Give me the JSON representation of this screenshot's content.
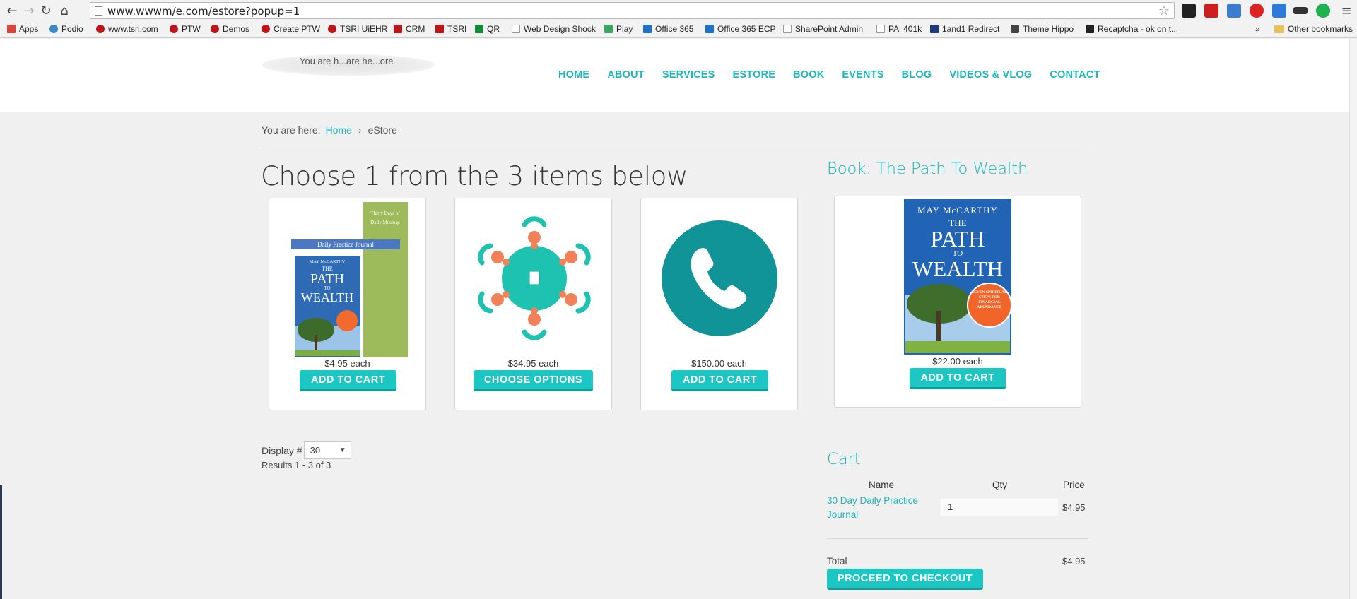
{
  "browser": {
    "url": "www.wwwm/e.com/estore?popup=1",
    "bookmarks": [
      {
        "label": "Apps",
        "color": "#d9453b"
      },
      {
        "label": "Podio",
        "color": "#3b88c3"
      },
      {
        "label": "www.tsri.com",
        "color": "#c0141b"
      },
      {
        "label": "PTW",
        "color": "#c0141b"
      },
      {
        "label": "Demos",
        "color": "#c0141b"
      },
      {
        "label": "Create PTW",
        "color": "#c0141b"
      },
      {
        "label": "TSRI UiEHR",
        "color": "#c0141b"
      },
      {
        "label": "CRM",
        "color": "#c0141b"
      },
      {
        "label": "TSRI",
        "color": "#c0141b"
      },
      {
        "label": "QR",
        "color": "#118b38"
      },
      {
        "label": "Web Design Shock",
        "color": "#bbbbbb"
      },
      {
        "label": "Play",
        "color": "#3ba760"
      },
      {
        "label": "Office 365",
        "color": "#1f72c9"
      },
      {
        "label": "Office 365 ECP",
        "color": "#1f72c9"
      },
      {
        "label": "SharePoint Admin",
        "color": "#bbbbbb"
      },
      {
        "label": "PAi 401k",
        "color": "#bbbbbb"
      },
      {
        "label": "1and1 Redirect",
        "color": "#1f3a7a"
      },
      {
        "label": "Theme Hippo",
        "color": "#444444"
      },
      {
        "label": "Recaptcha - ok on t...",
        "color": "#222222"
      }
    ],
    "other_bookmarks": "Other bookmarks",
    "overflow": "»"
  },
  "site": {
    "logo_text": "You are h...are he...ore",
    "nav": [
      "HOME",
      "ABOUT",
      "SERVICES",
      "ESTORE",
      "BOOK",
      "EVENTS",
      "BLOG",
      "VIDEOS & VLOG",
      "CONTACT"
    ]
  },
  "breadcrumb": {
    "prefix": "You are here:",
    "home": "Home",
    "separator": "›",
    "current": "eStore"
  },
  "page_title": "Choose 1 from the 3 items below",
  "products": [
    {
      "price": "$4.95 each",
      "button": "ADD TO CART"
    },
    {
      "price": "$34.95 each",
      "button": "CHOOSE OPTIONS"
    },
    {
      "price": "$150.00 each",
      "button": "ADD TO CART"
    }
  ],
  "journal_art": {
    "green_text_1": "Thirty Days of",
    "green_text_2": "Daily Musings",
    "banner": "Daily Practice Journal",
    "author": "MAY McCARTHY",
    "the": "THE",
    "path": "PATH",
    "to": "TO",
    "wealth": "WEALTH"
  },
  "display": {
    "label": "Display #",
    "value": "30",
    "results": "Results 1 - 3 of 3"
  },
  "sidebar": {
    "book_title": "Book: The Path To Wealth",
    "book_cover": {
      "author": "MAY McCARTHY",
      "the": "THE",
      "path": "PATH",
      "to": "TO",
      "wealth": "WEALTH",
      "badge": "SEVEN SPIRITUAL STEPS FOR FINANCIAL ABUNDANCE"
    },
    "book_price": "$22.00 each",
    "book_button": "ADD TO CART"
  },
  "cart": {
    "title": "Cart",
    "headers": {
      "name": "Name",
      "qty": "Qty",
      "price": "Price"
    },
    "item_name": "30 Day Daily Practice Journal",
    "item_qty": "1",
    "item_price": "$4.95",
    "total_label": "Total",
    "total_value": "$4.95",
    "checkout": "PROCEED TO CHECKOUT"
  },
  "colors": {
    "accent": "#1ab8b8",
    "button": "#1cc7c3",
    "phone": "#119497",
    "table": "#1ec2b0",
    "people": "#f2815a"
  }
}
